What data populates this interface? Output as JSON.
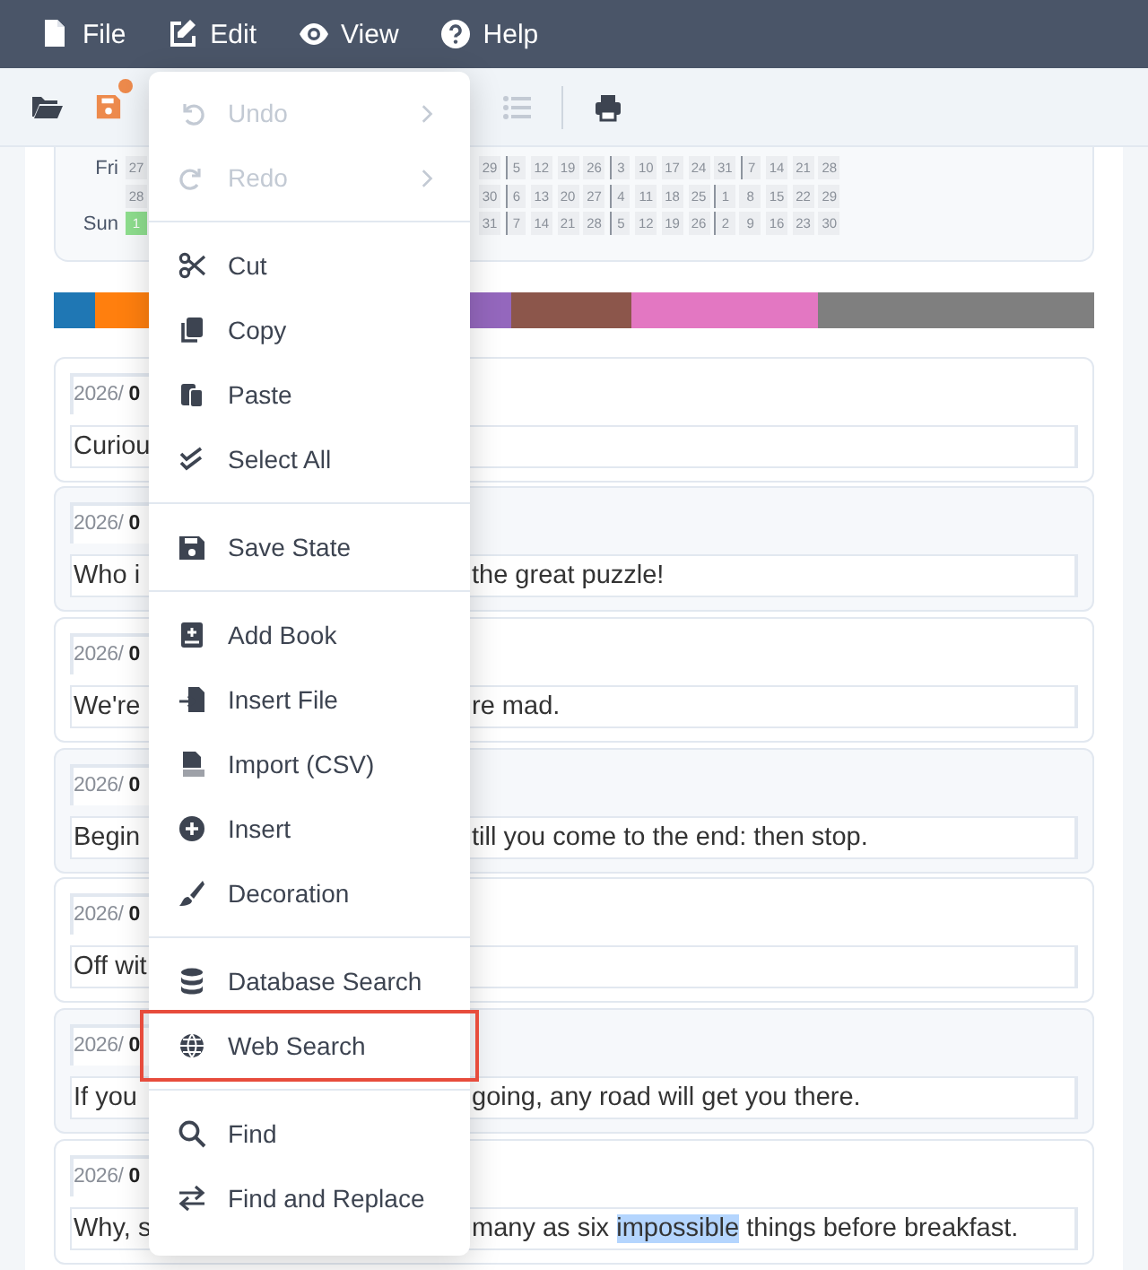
{
  "menubar": [
    {
      "label": "File"
    },
    {
      "label": "Edit"
    },
    {
      "label": "View"
    },
    {
      "label": "Help"
    }
  ],
  "toolbar": {
    "save_modified": true,
    "list_disabled": true
  },
  "calendar": [
    {
      "label": "Fri",
      "cells_left": [
        {
          "text": "27",
          "highlighted": false,
          "month_start": false
        }
      ],
      "cells_right": [
        {
          "text": "29",
          "highlighted": false,
          "month_start": false
        },
        {
          "text": "5",
          "highlighted": false,
          "month_start": true
        },
        {
          "text": "12",
          "highlighted": false,
          "month_start": false
        },
        {
          "text": "19",
          "highlighted": false,
          "month_start": false
        },
        {
          "text": "26",
          "highlighted": false,
          "month_start": false
        },
        {
          "text": "3",
          "highlighted": false,
          "month_start": true
        },
        {
          "text": "10",
          "highlighted": false,
          "month_start": false
        },
        {
          "text": "17",
          "highlighted": false,
          "month_start": false
        },
        {
          "text": "24",
          "highlighted": false,
          "month_start": false
        },
        {
          "text": "31",
          "highlighted": false,
          "month_start": false
        },
        {
          "text": "7",
          "highlighted": false,
          "month_start": true
        },
        {
          "text": "14",
          "highlighted": false,
          "month_start": false
        },
        {
          "text": "21",
          "highlighted": false,
          "month_start": false
        },
        {
          "text": "28",
          "highlighted": false,
          "month_start": false
        }
      ]
    },
    {
      "cells_left": [
        {
          "text": "28",
          "highlighted": false,
          "month_start": false
        }
      ],
      "cells_right": [
        {
          "text": "30",
          "highlighted": false,
          "month_start": false
        },
        {
          "text": "6",
          "highlighted": false,
          "month_start": true
        },
        {
          "text": "13",
          "highlighted": false,
          "month_start": false
        },
        {
          "text": "20",
          "highlighted": false,
          "month_start": false
        },
        {
          "text": "27",
          "highlighted": false,
          "month_start": false
        },
        {
          "text": "4",
          "highlighted": false,
          "month_start": true
        },
        {
          "text": "11",
          "highlighted": false,
          "month_start": false
        },
        {
          "text": "18",
          "highlighted": false,
          "month_start": false
        },
        {
          "text": "25",
          "highlighted": false,
          "month_start": false
        },
        {
          "text": "1",
          "highlighted": false,
          "month_start": true
        },
        {
          "text": "8",
          "highlighted": false,
          "month_start": false
        },
        {
          "text": "15",
          "highlighted": false,
          "month_start": false
        },
        {
          "text": "22",
          "highlighted": false,
          "month_start": false
        },
        {
          "text": "29",
          "highlighted": false,
          "month_start": false
        }
      ]
    },
    {
      "label": "Sun",
      "cells_left": [
        {
          "text": "1",
          "highlighted": true,
          "month_start": false
        }
      ],
      "cells_right": [
        {
          "text": "31",
          "highlighted": false,
          "month_start": false
        },
        {
          "text": "7",
          "highlighted": false,
          "month_start": true
        },
        {
          "text": "14",
          "highlighted": false,
          "month_start": false
        },
        {
          "text": "21",
          "highlighted": false,
          "month_start": false
        },
        {
          "text": "28",
          "highlighted": false,
          "month_start": false
        },
        {
          "text": "5",
          "highlighted": false,
          "month_start": true
        },
        {
          "text": "12",
          "highlighted": false,
          "month_start": false
        },
        {
          "text": "19",
          "highlighted": false,
          "month_start": false
        },
        {
          "text": "26",
          "highlighted": false,
          "month_start": false
        },
        {
          "text": "2",
          "highlighted": false,
          "month_start": true
        },
        {
          "text": "9",
          "highlighted": false,
          "month_start": false
        },
        {
          "text": "16",
          "highlighted": false,
          "month_start": false
        },
        {
          "text": "23",
          "highlighted": false,
          "month_start": false
        },
        {
          "text": "30",
          "highlighted": false,
          "month_start": false
        }
      ]
    }
  ],
  "color_bar": [
    {
      "color": "#1f77b4"
    },
    {
      "color": "#ff7f0e"
    },
    {
      "color": "#9467bd"
    },
    {
      "color": "#8c564b"
    },
    {
      "color": "#e377c2"
    },
    {
      "color": "#7f7f7f"
    }
  ],
  "entries": [
    {
      "date": "2026/ **0**",
      "left": "Curiou"
    },
    {
      "date": "2026/ **0**",
      "left": "Who i",
      "right": [
        {
          "text": "the great puzzle!",
          "selected": false
        }
      ]
    },
    {
      "date": "2026/ **0**",
      "left": "We're",
      "right": [
        {
          "text": "re mad.",
          "selected": false
        }
      ]
    },
    {
      "date": "2026/ **0**",
      "left": "Begin",
      "right": [
        {
          "text": "till you come to the end: then stop.",
          "selected": false
        }
      ]
    },
    {
      "date": "2026/ **0**",
      "left": "Off wit"
    },
    {
      "date": "2026/ **0**",
      "left": "If you",
      "right": [
        {
          "text": "going, any road will get you there.",
          "selected": false
        }
      ]
    },
    {
      "date": "2026/ **0**",
      "left": "Why, s",
      "right": [
        {
          "text": "many as six ",
          "selected": false
        },
        {
          "text": "impossible",
          "selected": true
        },
        {
          "text": " things before breakfast.",
          "selected": false
        }
      ]
    }
  ],
  "menu": [
    {
      "kind": "item",
      "label": "Undo",
      "disabled": true,
      "submenu": true,
      "selected": false
    },
    {
      "kind": "item",
      "label": "Redo",
      "disabled": true,
      "submenu": true,
      "selected": false
    },
    {
      "kind": "separator"
    },
    {
      "kind": "item",
      "label": "Cut",
      "disabled": false,
      "submenu": false,
      "selected": false
    },
    {
      "kind": "item",
      "label": "Copy",
      "disabled": false,
      "submenu": false,
      "selected": false
    },
    {
      "kind": "item",
      "label": "Paste",
      "disabled": false,
      "submenu": false,
      "selected": false
    },
    {
      "kind": "item",
      "label": "Select All",
      "disabled": false,
      "submenu": false,
      "selected": false
    },
    {
      "kind": "separator"
    },
    {
      "kind": "item",
      "label": "Save State",
      "disabled": false,
      "submenu": false,
      "selected": false
    },
    {
      "kind": "separator"
    },
    {
      "kind": "item",
      "label": "Add Book",
      "disabled": false,
      "submenu": false,
      "selected": false
    },
    {
      "kind": "item",
      "label": "Insert File",
      "disabled": false,
      "submenu": false,
      "selected": false
    },
    {
      "kind": "item",
      "label": "Import (CSV)",
      "disabled": false,
      "submenu": false,
      "selected": false
    },
    {
      "kind": "item",
      "label": "Insert",
      "disabled": false,
      "submenu": false,
      "selected": false
    },
    {
      "kind": "item",
      "label": "Decoration",
      "disabled": false,
      "submenu": false,
      "selected": false
    },
    {
      "kind": "separator"
    },
    {
      "kind": "item",
      "label": "Database Search",
      "disabled": false,
      "submenu": false,
      "selected": false
    },
    {
      "kind": "item",
      "label": "Web Search",
      "disabled": false,
      "submenu": false,
      "selected": true
    },
    {
      "kind": "separator"
    },
    {
      "kind": "item",
      "label": "Find",
      "disabled": false,
      "submenu": false,
      "selected": false
    },
    {
      "kind": "item",
      "label": "Find and Replace",
      "disabled": false,
      "submenu": false,
      "selected": false
    }
  ]
}
